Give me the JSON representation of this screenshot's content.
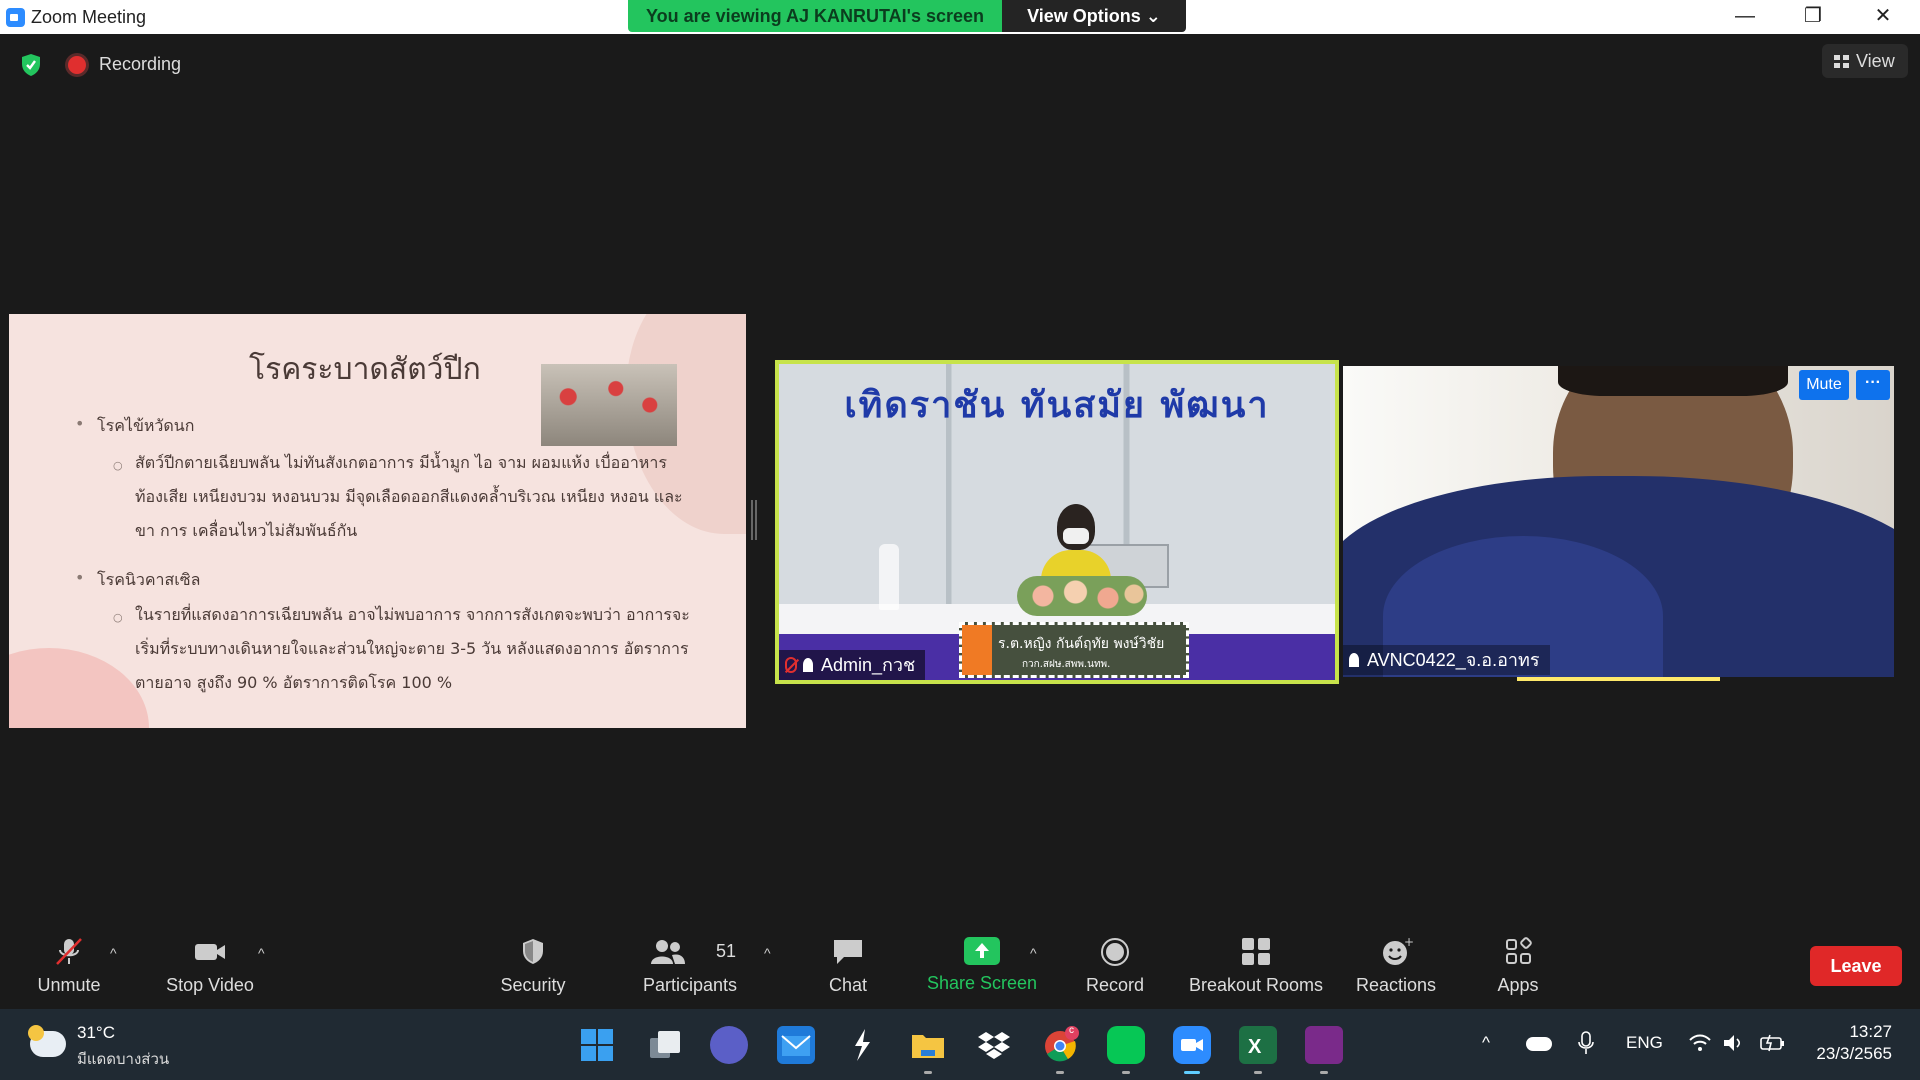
{
  "window": {
    "title": "Zoom Meeting",
    "share_banner": "You are viewing AJ KANRUTAI's screen",
    "view_options": "View Options ⌄",
    "minimize": "—",
    "restore": "❐",
    "close": "✕"
  },
  "meeting_bar": {
    "recording_label": "Recording",
    "view_label": "View"
  },
  "slide": {
    "title": "โรคระบาดสัตว์ปีก",
    "bullet1": "โรคไข้หวัดนก",
    "bullet1_line1": "สัตว์ปีกตายเฉียบพลัน ไม่ทันสังเกตอาการ มีน้ำมูก ไอ จาม ผอมแห้ง เบื่ออาหาร",
    "bullet1_line2": "ท้องเสีย เหนียงบวม หงอนบวม มีจุดเลือดออกสีแดงคล้ำบริเวณ เหนียง หงอน และ",
    "bullet1_line3": "ขา การ เคลื่อนไหวไม่สัมพันธ์กัน",
    "bullet2": "โรคนิวคาสเซิล",
    "bullet2_line1": "ในรายที่แสดงอาการเฉียบพลัน อาจไม่พบอาการ จากการสังเกตจะพบว่า อาการจะ",
    "bullet2_line2": "เริ่มที่ระบบทางเดินหายใจและส่วนใหญ่จะตาย 3-5 วัน หลังแสดงอาการ อัตราการ",
    "bullet2_line3": "ตายอาจ สูงถึง 90 % อัตราการติดโรค 100 %"
  },
  "tiles": {
    "admin": {
      "banner": "เทิดราชัน   ทันสมัย   พัฒนา",
      "nameplate_line1": "ร.ต.หญิง กันต์ฤทัย  พงษ์วิชัย",
      "nameplate_line2": "กวก.สฝษ.สพพ.นทพ.",
      "name": "Admin_กวช"
    },
    "guest": {
      "name": "AVNC0422_จ.อ.อาทร",
      "mute": "Mute",
      "more": "···"
    }
  },
  "toolbar": {
    "unmute": "Unmute",
    "stop_video": "Stop Video",
    "security": "Security",
    "participants": "Participants",
    "participants_count": "51",
    "chat": "Chat",
    "share_screen": "Share Screen",
    "record": "Record",
    "breakout_rooms": "Breakout Rooms",
    "reactions": "Reactions",
    "apps": "Apps",
    "leave": "Leave",
    "caret": "^"
  },
  "taskbar": {
    "temperature": "31°C",
    "weather": "มีแดดบางส่วน",
    "language": "ENG",
    "time": "13:27",
    "date": "23/3/2565",
    "chrome_badge": "c",
    "tray_up": "^"
  },
  "colors": {
    "share_green": "#23c55e",
    "leave_red": "#e02828",
    "accent_blue": "#0e72ed",
    "active_speaker": "#c7e34b"
  }
}
